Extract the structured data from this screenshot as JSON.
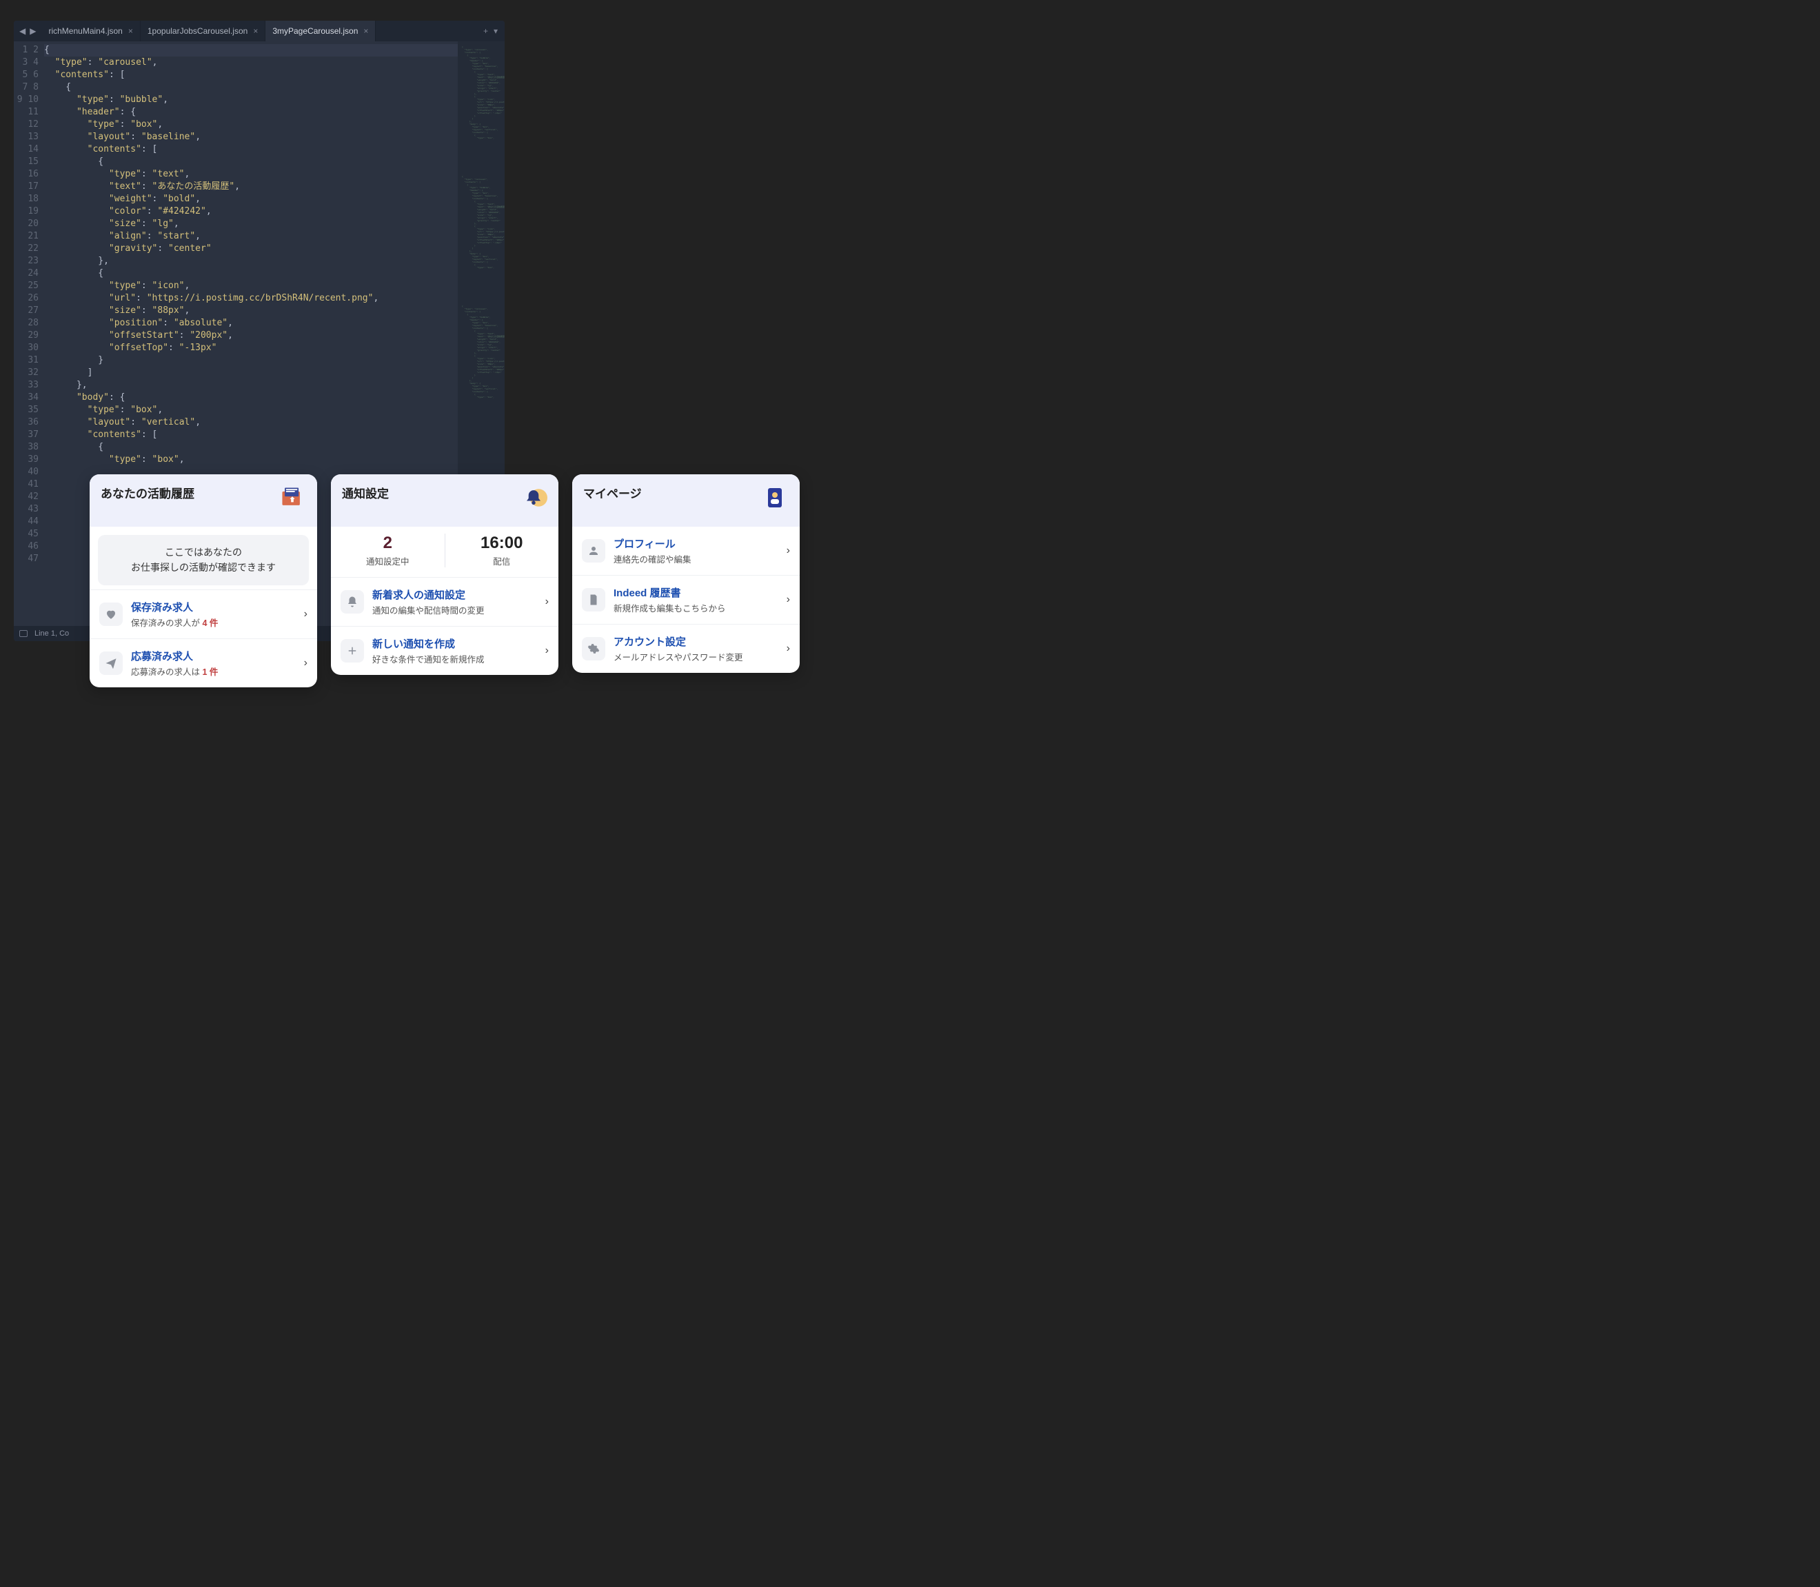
{
  "editor": {
    "tabs": [
      {
        "label": "richMenuMain4.json",
        "active": false
      },
      {
        "label": "1popularJobsCarousel.json",
        "active": false
      },
      {
        "label": "3myPageCarousel.json",
        "active": true
      }
    ],
    "status": "Line 1, Co",
    "lines": [
      "{",
      "  \"type\": \"carousel\",",
      "  \"contents\": [",
      "    {",
      "      \"type\": \"bubble\",",
      "      \"header\": {",
      "        \"type\": \"box\",",
      "        \"layout\": \"baseline\",",
      "        \"contents\": [",
      "          {",
      "            \"type\": \"text\",",
      "            \"text\": \"あなたの活動履歴\",",
      "            \"weight\": \"bold\",",
      "            \"color\": \"#424242\",",
      "            \"size\": \"lg\",",
      "            \"align\": \"start\",",
      "            \"gravity\": \"center\"",
      "          },",
      "          {",
      "            \"type\": \"icon\",",
      "            \"url\": \"https://i.postimg.cc/brDShR4N/recent.png\",",
      "            \"size\": \"88px\",",
      "            \"position\": \"absolute\",",
      "            \"offsetStart\": \"200px\",",
      "            \"offsetTop\": \"-13px\"",
      "          }",
      "        ]",
      "      },",
      "      \"body\": {",
      "        \"type\": \"box\",",
      "        \"layout\": \"vertical\",",
      "        \"contents\": [",
      "          {",
      "            \"type\": \"box\",",
      "",
      "",
      "",
      "",
      "",
      "",
      "",
      "",
      "",
      "",
      "",
      "",
      ""
    ]
  },
  "cards": {
    "activity": {
      "title": "あなたの活動履歴",
      "banner_line1": "ここではあなたの",
      "banner_line2": "お仕事探しの活動が確認できます",
      "rows": [
        {
          "icon": "heart",
          "title": "保存済み求人",
          "sub_pre": "保存済みの求人が ",
          "count": "4 件"
        },
        {
          "icon": "send",
          "title": "応募済み求人",
          "sub_pre": "応募済みの求人は ",
          "count": "1 件"
        }
      ]
    },
    "notify": {
      "title": "通知設定",
      "stats": [
        {
          "big": "2",
          "lab": "通知設定中"
        },
        {
          "big": "16:00",
          "lab": "配信"
        }
      ],
      "rows": [
        {
          "icon": "bell",
          "title": "新着求人の通知設定",
          "sub": "通知の編集や配信時間の変更"
        },
        {
          "icon": "plus",
          "title": "新しい通知を作成",
          "sub": "好きな条件で通知を新規作成"
        }
      ]
    },
    "mypage": {
      "title": "マイページ",
      "rows": [
        {
          "icon": "person",
          "title": "プロフィール",
          "sub": "連絡先の確認や編集"
        },
        {
          "icon": "doc",
          "title": "Indeed 履歴書",
          "sub": "新規作成も編集もこちらから"
        },
        {
          "icon": "gear",
          "title": "アカウント設定",
          "sub": "メールアドレスやパスワード変更"
        }
      ]
    }
  }
}
